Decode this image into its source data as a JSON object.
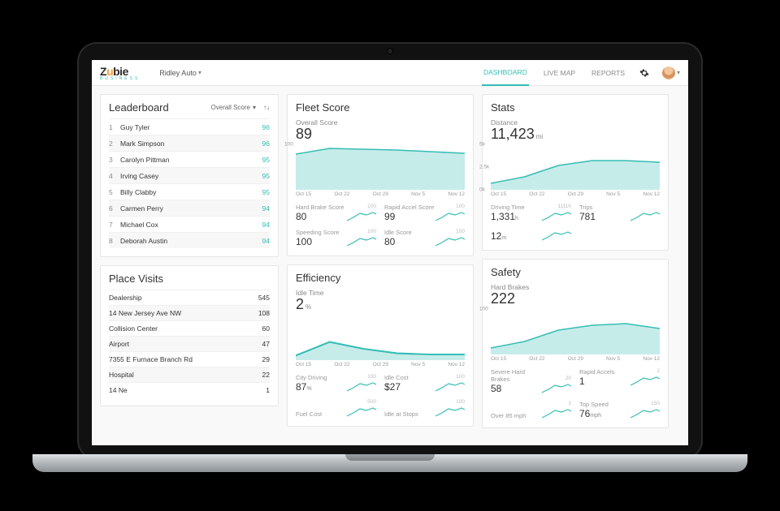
{
  "brand": {
    "name_a": "Z",
    "name_u": "u",
    "name_b": "bie",
    "sub": "BUSINESS"
  },
  "company": "Ridley Auto",
  "nav": {
    "dashboard": "DASHBOARD",
    "livemap": "LIVE MAP",
    "reports": "REPORTS"
  },
  "leaderboard": {
    "title": "Leaderboard",
    "filter": "Overall Score",
    "rows": [
      {
        "rank": 1,
        "name": "Guy Tyler",
        "score": 96
      },
      {
        "rank": 2,
        "name": "Mark Simpson",
        "score": 96
      },
      {
        "rank": 3,
        "name": "Carolyn Pittman",
        "score": 95
      },
      {
        "rank": 4,
        "name": "Irving Casey",
        "score": 95
      },
      {
        "rank": 5,
        "name": "Billy Clabby",
        "score": 95
      },
      {
        "rank": 6,
        "name": "Carmen Perry",
        "score": 94
      },
      {
        "rank": 7,
        "name": "Michael Cox",
        "score": 94
      },
      {
        "rank": 8,
        "name": "Deborah Austin",
        "score": 94
      }
    ]
  },
  "place_visits": {
    "title": "Place Visits",
    "rows": [
      {
        "place": "Dealership",
        "count": 545
      },
      {
        "place": "14 New Jersey Ave NW",
        "count": 108
      },
      {
        "place": "Collision Center",
        "count": 60
      },
      {
        "place": "Airport",
        "count": 47
      },
      {
        "place": "7355 E Furnace Branch Rd",
        "count": 29
      },
      {
        "place": "Hospital",
        "count": 22
      },
      {
        "place": "14 Ne",
        "count": 1
      }
    ]
  },
  "fleet": {
    "title": "Fleet Score",
    "overall_label": "Overall Score",
    "overall_value": "89",
    "sub": [
      {
        "label": "Hard Brake Score",
        "value": "80",
        "max": "100"
      },
      {
        "label": "Rapid Accel Score",
        "value": "99",
        "max": "100"
      },
      {
        "label": "Speeding Score",
        "value": "100",
        "max": "100"
      },
      {
        "label": "Idle Score",
        "value": "80",
        "max": "100"
      }
    ]
  },
  "efficiency": {
    "title": "Efficiency",
    "idle_label": "Idle Time",
    "idle_value": "2",
    "idle_unit": "%",
    "sub": [
      {
        "label": "City Driving",
        "value": "87",
        "unit": "%",
        "max": "100"
      },
      {
        "label": "Idle Cost",
        "value": "27",
        "unit": "",
        "prefix": "$",
        "max": "100"
      },
      {
        "label": "Fuel Cost",
        "value": "",
        "unit": "",
        "max": "500"
      },
      {
        "label": "Idle at Stops",
        "value": "",
        "unit": "",
        "max": "100"
      }
    ]
  },
  "stats": {
    "title": "Stats",
    "distance_label": "Distance",
    "distance_value": "11,423",
    "distance_unit": "mi",
    "yticks": [
      "5k",
      "2.5k",
      "0k"
    ],
    "sub": [
      {
        "label": "Driving Time",
        "value": "1,331",
        "unit": "h",
        "side": "1111h"
      },
      {
        "label": "Trips",
        "value": "781",
        "unit": "",
        "side": ""
      },
      {
        "label": "",
        "value": "12",
        "unit": "m",
        "side": ""
      }
    ]
  },
  "safety": {
    "title": "Safety",
    "hb_label": "Hard Brakes",
    "hb_value": "222",
    "sub": [
      {
        "label": "Severe Hard Brakes",
        "value": "58",
        "side": "20"
      },
      {
        "label": "Rapid Accels",
        "value": "1",
        "side": "2"
      },
      {
        "label": "Over 85 mph",
        "value": "",
        "side": "1"
      },
      {
        "label": "Top Speed",
        "value": "76",
        "unit": "mph",
        "side": "150"
      }
    ]
  },
  "dates": [
    "Oct 15",
    "Oct 22",
    "Oct 29",
    "Nov 5",
    "Nov 12"
  ],
  "chart_data": [
    {
      "type": "line",
      "title": "Fleet Overall Score",
      "x": [
        "Oct 15",
        "Oct 22",
        "Oct 29",
        "Nov 5",
        "Nov 12"
      ],
      "values": [
        86,
        92,
        91,
        90,
        88
      ],
      "ylim": [
        0,
        100
      ]
    },
    {
      "type": "line",
      "title": "Stats Distance (mi)",
      "x": [
        "Oct 15",
        "Oct 22",
        "Oct 29",
        "Nov 5",
        "Nov 12"
      ],
      "values": [
        700,
        1400,
        2800,
        3300,
        3200
      ],
      "ylim": [
        0,
        5000
      ]
    },
    {
      "type": "line",
      "title": "Efficiency Idle Time %",
      "x": [
        "Oct 15",
        "Oct 22",
        "Oct 29",
        "Nov 5",
        "Nov 12"
      ],
      "values": [
        1,
        4,
        3,
        2,
        2
      ],
      "ylim": [
        0,
        10
      ]
    },
    {
      "type": "line",
      "title": "Safety Hard Brakes",
      "x": [
        "Oct 15",
        "Oct 22",
        "Oct 29",
        "Nov 5",
        "Nov 12"
      ],
      "values": [
        15,
        28,
        55,
        68,
        56
      ],
      "ylim": [
        0,
        100
      ]
    }
  ]
}
